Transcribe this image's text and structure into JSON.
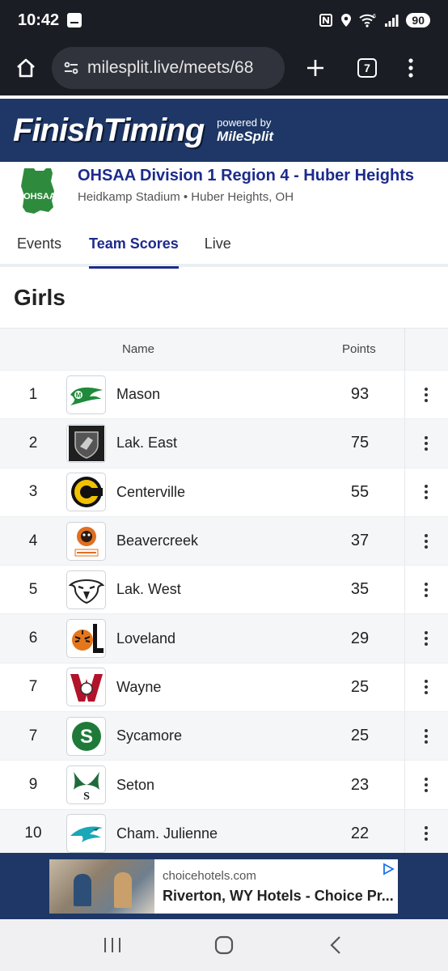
{
  "status_bar": {
    "time": "10:42",
    "battery": "90",
    "signal_label": "6"
  },
  "browser": {
    "url": "milesplit.live/meets/68",
    "tab_count": "7"
  },
  "banner": {
    "logo_text": "FinishTiming",
    "powered_label": "powered by",
    "powered_brand": "MileSplit"
  },
  "meet": {
    "logo_text": "OHSAA",
    "title": "OHSAA Division 1 Region 4 - Huber Heights",
    "venue": "Heidkamp Stadium • Huber Heights, OH"
  },
  "tabs": [
    {
      "label": "Events",
      "active": false
    },
    {
      "label": "Team Scores",
      "active": true
    },
    {
      "label": "Live",
      "active": false
    }
  ],
  "section_title": "Girls",
  "table": {
    "headers": {
      "name": "Name",
      "points": "Points"
    },
    "rows": [
      {
        "place": "1",
        "name": "Mason",
        "points": "93",
        "logo_icon": "mason-comets-logo",
        "logo_color": "#1f8a3a"
      },
      {
        "place": "2",
        "name": "Lak. East",
        "points": "75",
        "logo_icon": "hawks-shield-logo",
        "logo_color": "#333333"
      },
      {
        "place": "3",
        "name": "Centerville",
        "points": "55",
        "logo_icon": "elks-c-logo",
        "logo_color": "#f2c200"
      },
      {
        "place": "4",
        "name": "Beavercreek",
        "points": "37",
        "logo_icon": "beaver-logo",
        "logo_color": "#e07020"
      },
      {
        "place": "5",
        "name": "Lak. West",
        "points": "35",
        "logo_icon": "eagle-head-logo",
        "logo_color": "#222222"
      },
      {
        "place": "6",
        "name": "Loveland",
        "points": "29",
        "logo_icon": "tiger-l-logo",
        "logo_color": "#e4761c"
      },
      {
        "place": "7",
        "name": "Wayne",
        "points": "25",
        "logo_icon": "wayne-w-logo",
        "logo_color": "#b3122b"
      },
      {
        "place": "7",
        "name": "Sycamore",
        "points": "25",
        "logo_icon": "sycamore-s-logo",
        "logo_color": "#1f7a3a"
      },
      {
        "place": "9",
        "name": "Seton",
        "points": "23",
        "logo_icon": "seton-wings-logo",
        "logo_color": "#1f6a3a"
      },
      {
        "place": "10",
        "name": "Cham. Julienne",
        "points": "22",
        "logo_icon": "eagle-wing-logo",
        "logo_color": "#1aa7b8"
      }
    ]
  },
  "ad": {
    "domain": "choicehotels.com",
    "headline": "Riverton, WY Hotels - Choice Pr..."
  },
  "colors": {
    "accent": "#1d2b8c",
    "banner_bg": "#1e3766",
    "system_bar_bg": "#1b1d24"
  }
}
